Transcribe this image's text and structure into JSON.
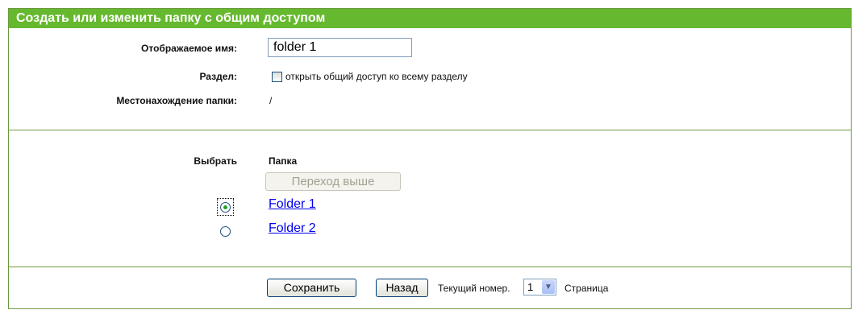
{
  "header": {
    "title": "Создать или изменить папку с общим доступом"
  },
  "form": {
    "display_name_label": "Отображаемое имя:",
    "display_name_value": "folder 1",
    "partition_label": "Раздел:",
    "share_all_label": "открыть общий доступ ко всему разделу",
    "share_all_checked": false,
    "location_label": "Местонахождение папки:",
    "location_value": "/"
  },
  "browser": {
    "select_header": "Выбрать",
    "folder_header": "Папка",
    "up_button": "Переход выше",
    "folders": [
      {
        "name": "Folder 1",
        "selected": true
      },
      {
        "name": "Folder 2",
        "selected": false
      }
    ]
  },
  "footer": {
    "save_button": "Сохранить",
    "back_button": "Назад",
    "current_page_label": "Текущий номер.",
    "current_page_value": "1",
    "page_label": "Страница"
  },
  "colors": {
    "header_bg": "#66b92f",
    "border": "#6a9a3d",
    "link": "#0000ee"
  },
  "icons": {
    "dropdown": "chevron-down-icon"
  }
}
